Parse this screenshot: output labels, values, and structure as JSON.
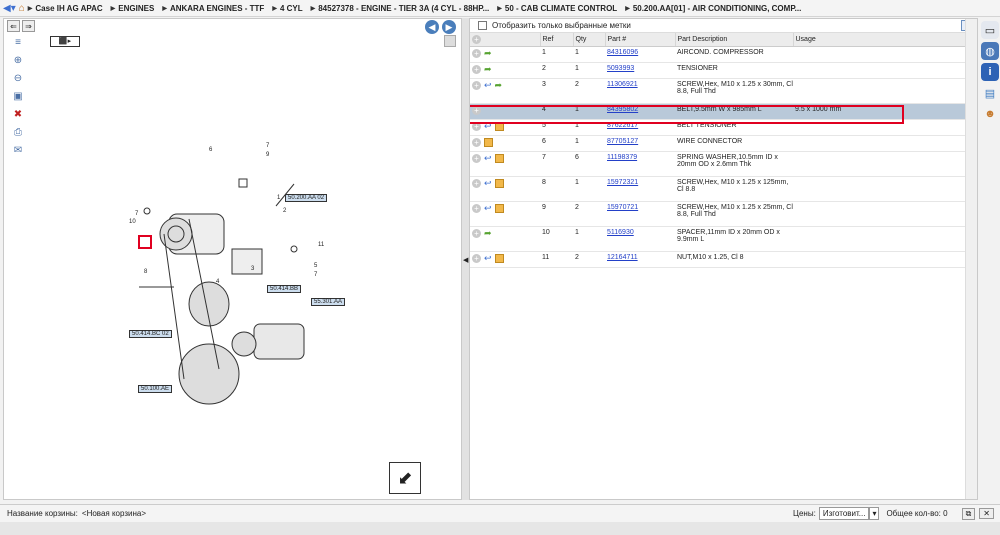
{
  "breadcrumb": [
    "Case IH AG APAC",
    "ENGINES",
    "ANKARA ENGINES - TTF",
    "4 CYL",
    "84527378 - ENGINE - TIER 3A (4 CYL - 88HP...",
    "50 - CAB CLIMATE CONTROL",
    "50.200.AA[01] - AIR CONDITIONING, COMP..."
  ],
  "filter_label": "Отобразить только выбранные метки",
  "columns": {
    "ref": "Ref",
    "qty": "Qty",
    "part": "Part #",
    "desc": "Part Description",
    "usage": "Usage"
  },
  "rows": [
    {
      "ref": "1",
      "qty": "1",
      "part": "84316096",
      "desc": "AIRCOND. COMPRESSOR",
      "usage": "",
      "icons": "f"
    },
    {
      "ref": "2",
      "qty": "1",
      "part": "5093993",
      "desc": "TENSIONER",
      "usage": "",
      "icons": "f"
    },
    {
      "ref": "3",
      "qty": "2",
      "part": "11306921",
      "desc": "SCREW,Hex, M10 x 1.25 x 30mm, Cl 8.8, Full Thd",
      "usage": "",
      "icons": "bf"
    },
    {
      "ref": "4",
      "qty": "1",
      "part": "84395802",
      "desc": "BELT,9.5mm W x 985mm L",
      "usage": "9.5 x 1000 mm",
      "icons": "",
      "selected": true
    },
    {
      "ref": "5",
      "qty": "1",
      "part": "87622617",
      "desc": "BELT TENSIONER",
      "usage": "",
      "icons": "bx"
    },
    {
      "ref": "6",
      "qty": "1",
      "part": "87705127",
      "desc": "WIRE CONNECTOR",
      "usage": "",
      "icons": "x"
    },
    {
      "ref": "7",
      "qty": "6",
      "part": "11198379",
      "desc": "SPRING WASHER,10.5mm ID x 20mm OD x 2.6mm Thk",
      "usage": "",
      "icons": "bx"
    },
    {
      "ref": "8",
      "qty": "1",
      "part": "15972321",
      "desc": "SCREW,Hex, M10 x 1.25 x 125mm, Cl 8.8",
      "usage": "",
      "icons": "bx"
    },
    {
      "ref": "9",
      "qty": "2",
      "part": "15970721",
      "desc": "SCREW,Hex, M10 x 1.25 x 25mm, Cl 8.8, Full Thd",
      "usage": "",
      "icons": "bx"
    },
    {
      "ref": "10",
      "qty": "1",
      "part": "5116930",
      "desc": "SPACER,11mm ID x 20mm OD x 9.9mm L",
      "usage": "",
      "icons": "f"
    },
    {
      "ref": "11",
      "qty": "2",
      "part": "12164711",
      "desc": "NUT,M10 x 1.25, Cl 8",
      "usage": "",
      "icons": "bx"
    }
  ],
  "diagram": {
    "callouts": [
      "50.200.AA 02",
      "50.414.BB",
      "55.301.AA",
      "50.414.BC 02",
      "50.100.AE"
    ],
    "labels": [
      "6",
      "7",
      "9",
      "1",
      "2",
      "3",
      "4",
      "5",
      "7",
      "8",
      "11",
      "10",
      "7"
    ]
  },
  "status": {
    "cart_label": "Название корзины:",
    "cart_value": "<Новая корзина>",
    "prices_label": "Цены:",
    "prices_value": "Изготовит...",
    "total": "Общее кол-во: 0"
  },
  "colors": {
    "selection": "#b9c9d9",
    "highlight": "#e00020",
    "link": "#2340c8"
  }
}
